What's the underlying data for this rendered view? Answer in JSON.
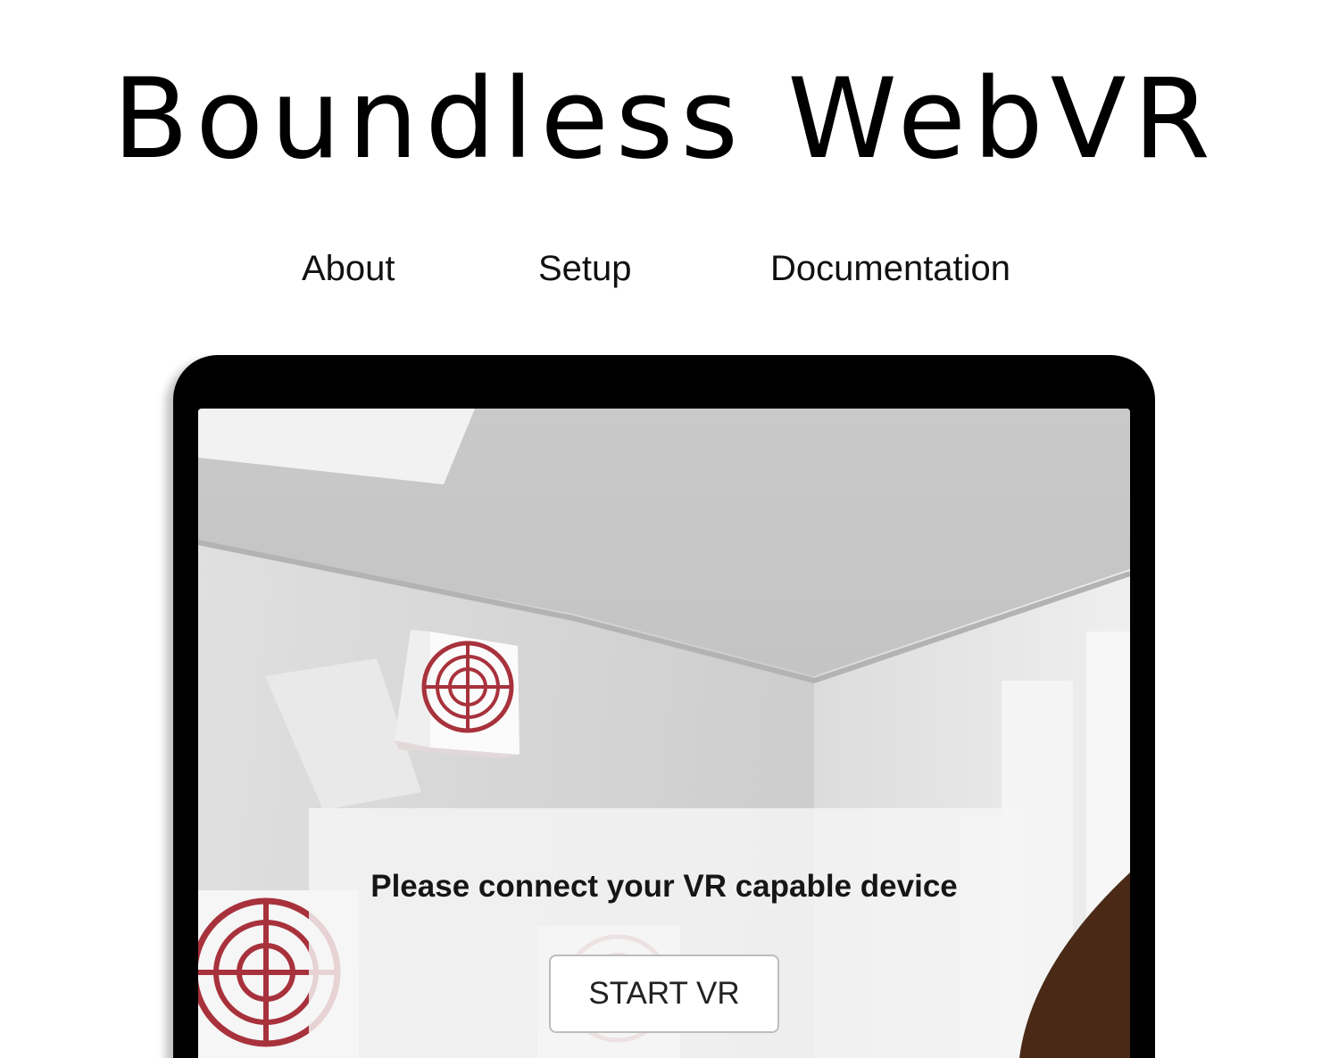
{
  "header": {
    "title": "Boundless WebVR"
  },
  "nav": {
    "items": [
      {
        "label": "About"
      },
      {
        "label": "Setup"
      },
      {
        "label": "Documentation"
      }
    ]
  },
  "vr_preview": {
    "message": "Please connect your VR capable device",
    "start_button_label": "START VR"
  },
  "colors": {
    "target_red": "#a8323c",
    "frame": "#000000",
    "room_wall": "#d9d9d9",
    "panel": "#f5f5f5",
    "chair_brown": "#4a2a17"
  },
  "icons": [
    "target-icon",
    "target-icon",
    "target-icon"
  ]
}
